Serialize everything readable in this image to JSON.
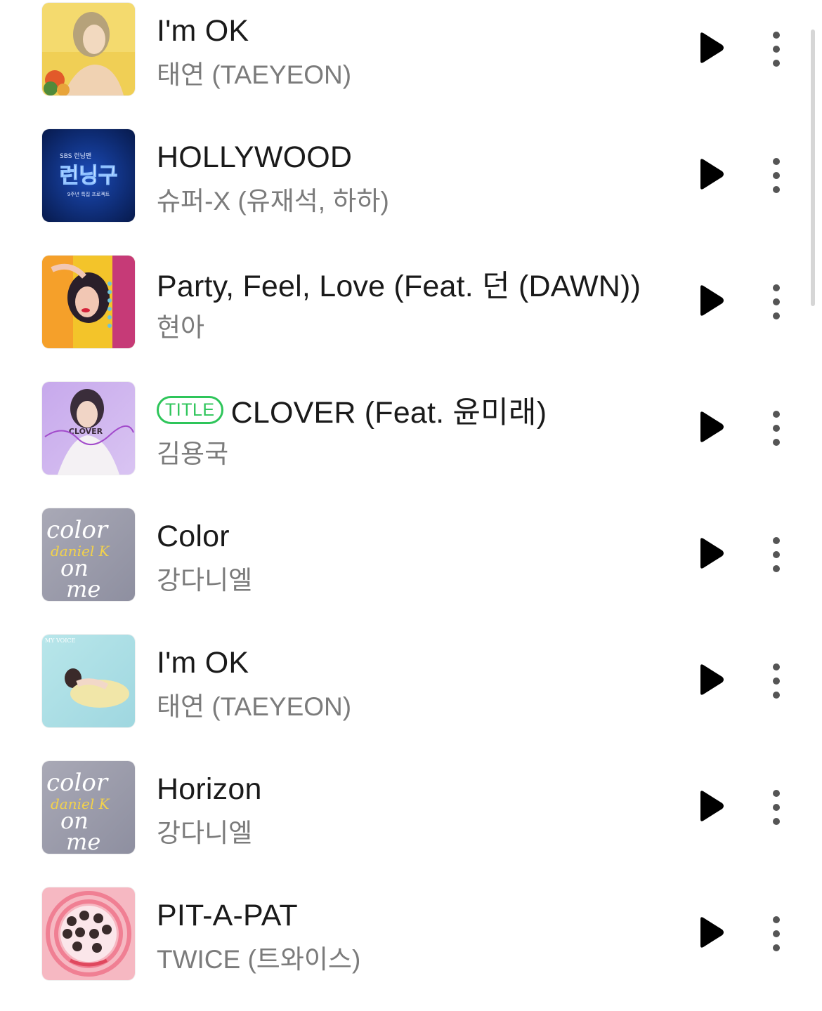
{
  "songs": [
    {
      "title": "I'm OK",
      "artist": "태연 (TAEYEON)",
      "badge": "",
      "art": "art-taeyeon-yellow"
    },
    {
      "title": "HOLLYWOOD",
      "artist": "슈퍼-X (유재석, 하하)",
      "badge": "",
      "art": "art-running-man"
    },
    {
      "title": "Party, Feel, Love (Feat. 던 (DAWN))",
      "artist": "현아",
      "badge": "",
      "art": "art-hyuna"
    },
    {
      "title": "CLOVER (Feat. 윤미래)",
      "artist": "김용국",
      "badge": "TITLE",
      "art": "art-clover"
    },
    {
      "title": "Color",
      "artist": "강다니엘",
      "badge": "",
      "art": "art-color-on-me"
    },
    {
      "title": "I'm OK",
      "artist": "태연 (TAEYEON)",
      "badge": "",
      "art": "art-my-voice"
    },
    {
      "title": "Horizon",
      "artist": "강다니엘",
      "badge": "",
      "art": "art-color-on-me"
    },
    {
      "title": "PIT-A-PAT",
      "artist": "TWICE (트와이스)",
      "badge": "",
      "art": "art-twice"
    }
  ],
  "art_text": {
    "running_man_top": "SBS 런닝맨",
    "running_man_main": "런닝구",
    "running_man_sub": "9주년 특집 프로젝트",
    "clover": "CLOVER",
    "color_word": "color",
    "color_name": "daniel K",
    "color_on": "on",
    "color_me": "me",
    "my_voice": "MY VOICE"
  },
  "icons": {
    "play": "play-icon",
    "more": "more-vertical-icon"
  },
  "colors": {
    "title_text": "#1a1a1a",
    "artist_text": "#7b7b7b",
    "badge": "#2ec55a",
    "icon": "#000000",
    "more_dots": "#555555"
  }
}
